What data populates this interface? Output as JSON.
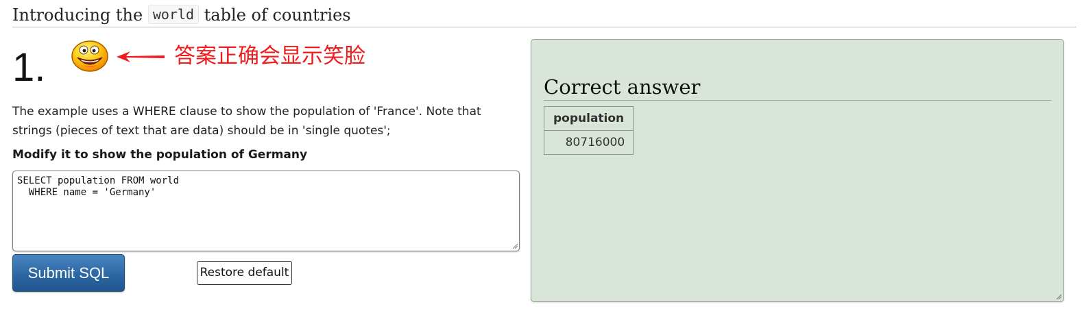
{
  "header": {
    "title_prefix": "Introducing the",
    "title_code": "world",
    "title_suffix": "table of countries"
  },
  "question": {
    "number": "1.",
    "feedback_icon": "smiley-face-icon",
    "annotation": {
      "icon": "arrow-left-icon",
      "text": "答案正确会显示笑脸",
      "color": "#ef1d1d"
    },
    "description": "The example uses a WHERE clause to show the population of 'France'. Note that strings (pieces of text that are data) should be in 'single quotes';",
    "task": "Modify it to show the population of Germany"
  },
  "editor": {
    "value": "SELECT population FROM world\n  WHERE name = 'Germany'"
  },
  "buttons": {
    "submit_label": "Submit SQL",
    "restore_label": "Restore default",
    "submit_color": "#2c67a4"
  },
  "result": {
    "heading": "Correct answer",
    "background": "#d9e5d9",
    "table": {
      "columns": [
        "population"
      ],
      "rows": [
        [
          "80716000"
        ]
      ]
    }
  }
}
